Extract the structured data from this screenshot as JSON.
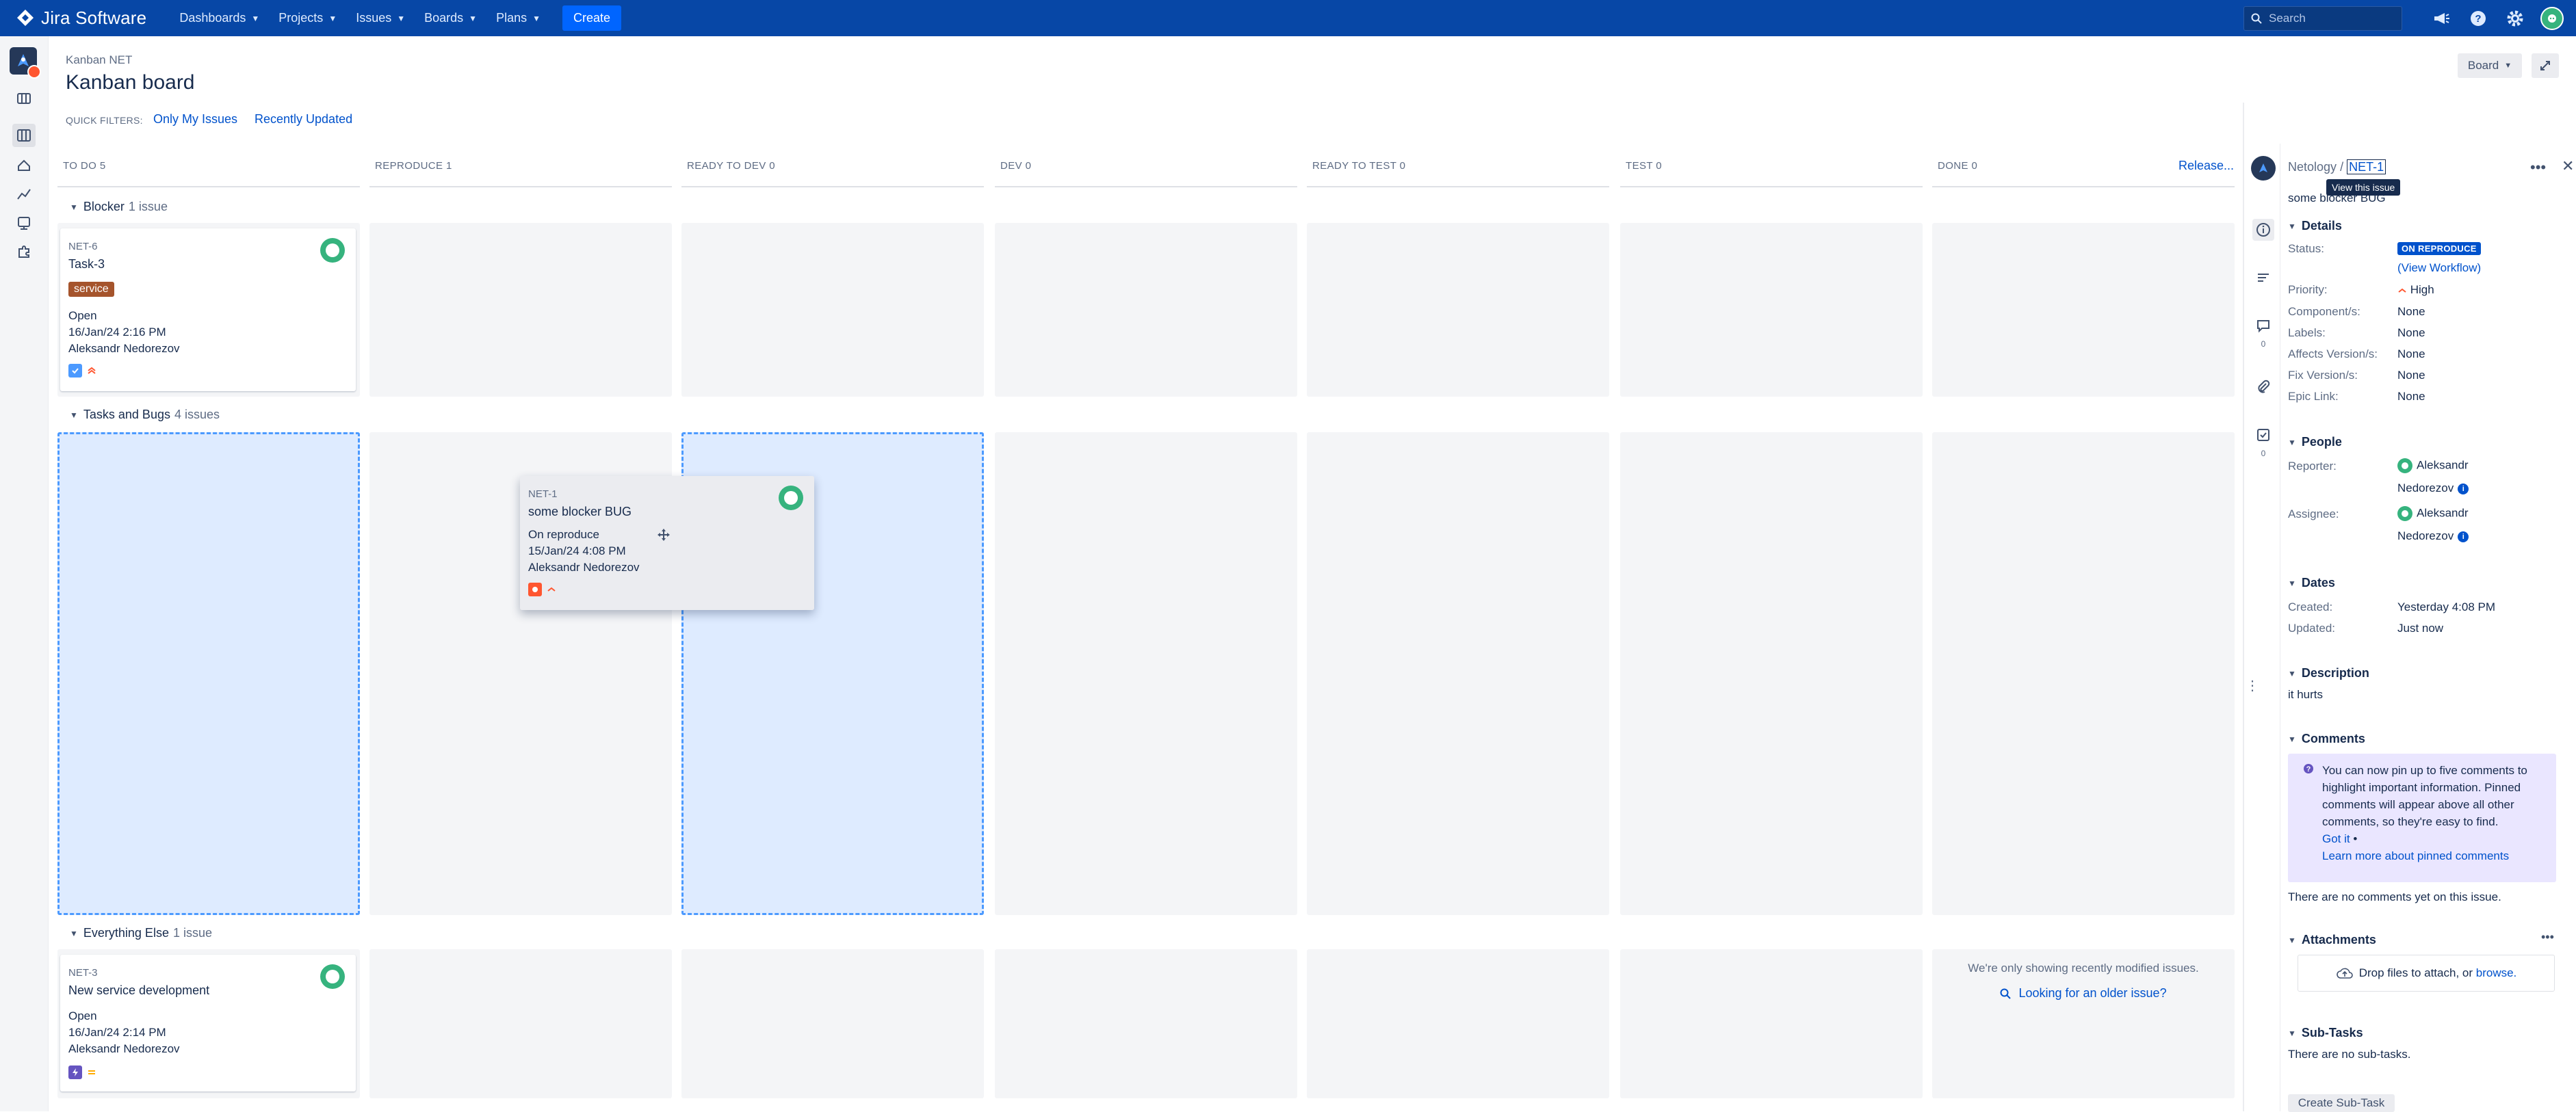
{
  "app": {
    "product": "Jira Software",
    "nav": [
      "Dashboards",
      "Projects",
      "Issues",
      "Boards",
      "Plans"
    ],
    "create_label": "Create",
    "search_placeholder": "Search"
  },
  "header": {
    "breadcrumb": "Kanban NET",
    "title": "Kanban board",
    "quick_filters_label": "QUICK FILTERS:",
    "quick_filters": [
      "Only My Issues",
      "Recently Updated"
    ],
    "board_button": "Board",
    "release_link": "Release..."
  },
  "columns": [
    {
      "name": "TO DO",
      "count": "5"
    },
    {
      "name": "REPRODUCE",
      "count": "1"
    },
    {
      "name": "READY TO DEV",
      "count": "0"
    },
    {
      "name": "DEV",
      "count": "0"
    },
    {
      "name": "READY TO TEST",
      "count": "0"
    },
    {
      "name": "TEST",
      "count": "0"
    },
    {
      "name": "DONE",
      "count": "0"
    }
  ],
  "swimlanes": [
    {
      "name": "Blocker",
      "count": "1 issue"
    },
    {
      "name": "Tasks and Bugs",
      "count": "4 issues"
    },
    {
      "name": "Everything Else",
      "count": "1 issue"
    }
  ],
  "cards": {
    "net6": {
      "key": "NET-6",
      "summary": "Task-3",
      "label": "service",
      "status": "Open",
      "date": "16/Jan/24 2:16 PM",
      "assignee": "Aleksandr Nedorezov"
    },
    "net1": {
      "key": "NET-1",
      "summary": "some blocker BUG",
      "status": "On reproduce",
      "date": "15/Jan/24 4:08 PM",
      "assignee": "Aleksandr Nedorezov"
    },
    "net3": {
      "key": "NET-3",
      "summary": "New service development",
      "status": "Open",
      "date": "16/Jan/24 2:14 PM",
      "assignee": "Aleksandr Nedorezov"
    }
  },
  "done_note": {
    "text": "We're only showing recently modified issues.",
    "link": "Looking for an older issue?"
  },
  "detail": {
    "project": "Netology",
    "sep": "/",
    "issue_key": "NET-1",
    "tooltip": "View this issue",
    "summary": "some blocker BUG",
    "rail_counts": {
      "comments": "0",
      "checklist": "0"
    },
    "sections": {
      "details": "Details",
      "people": "People",
      "dates": "Dates",
      "description": "Description",
      "comments": "Comments",
      "attachments": "Attachments",
      "subtasks": "Sub-Tasks"
    },
    "fields": {
      "status_label": "Status:",
      "status_value": "ON REPRODUCE",
      "view_workflow": "(View Workflow)",
      "priority_label": "Priority:",
      "priority_value": "High",
      "components_label": "Component/s:",
      "components_value": "None",
      "labels_label": "Labels:",
      "labels_value": "None",
      "affects_label": "Affects Version/s:",
      "affects_value": "None",
      "fix_label": "Fix Version/s:",
      "fix_value": "None",
      "epic_label": "Epic Link:",
      "epic_value": "None"
    },
    "people": {
      "reporter_label": "Reporter:",
      "reporter_first": "Aleksandr",
      "reporter_last": "Nedorezov",
      "assignee_label": "Assignee:",
      "assignee_first": "Aleksandr",
      "assignee_last": "Nedorezov"
    },
    "dates": {
      "created_label": "Created:",
      "created_value": "Yesterday 4:08 PM",
      "updated_label": "Updated:",
      "updated_value": "Just now"
    },
    "description": "it hurts",
    "pin_notice": {
      "line1": "You can now pin up to five comments to",
      "line2": "highlight important information. Pinned",
      "line3": "comments will appear above all other",
      "line4": "comments, so they're easy to find.",
      "got_it": "Got it",
      "dot": "•",
      "learn_more": "Learn more about pinned comments"
    },
    "no_comments": "There are no comments yet on this issue.",
    "attach_text": "Drop files to attach, or",
    "attach_link": "browse.",
    "no_subtasks": "There are no sub-tasks.",
    "create_subtask": "Create Sub-Task"
  },
  "colors": {
    "nav_bg": "#0747a6",
    "link": "#0052cc",
    "drop_bg": "#deebff",
    "drop_border": "#4c9aff",
    "label_chip": "#a5542c",
    "status_lozenge": "#0052cc",
    "priority_high": "#ff5630",
    "pin_notice_bg": "#eae6ff"
  }
}
